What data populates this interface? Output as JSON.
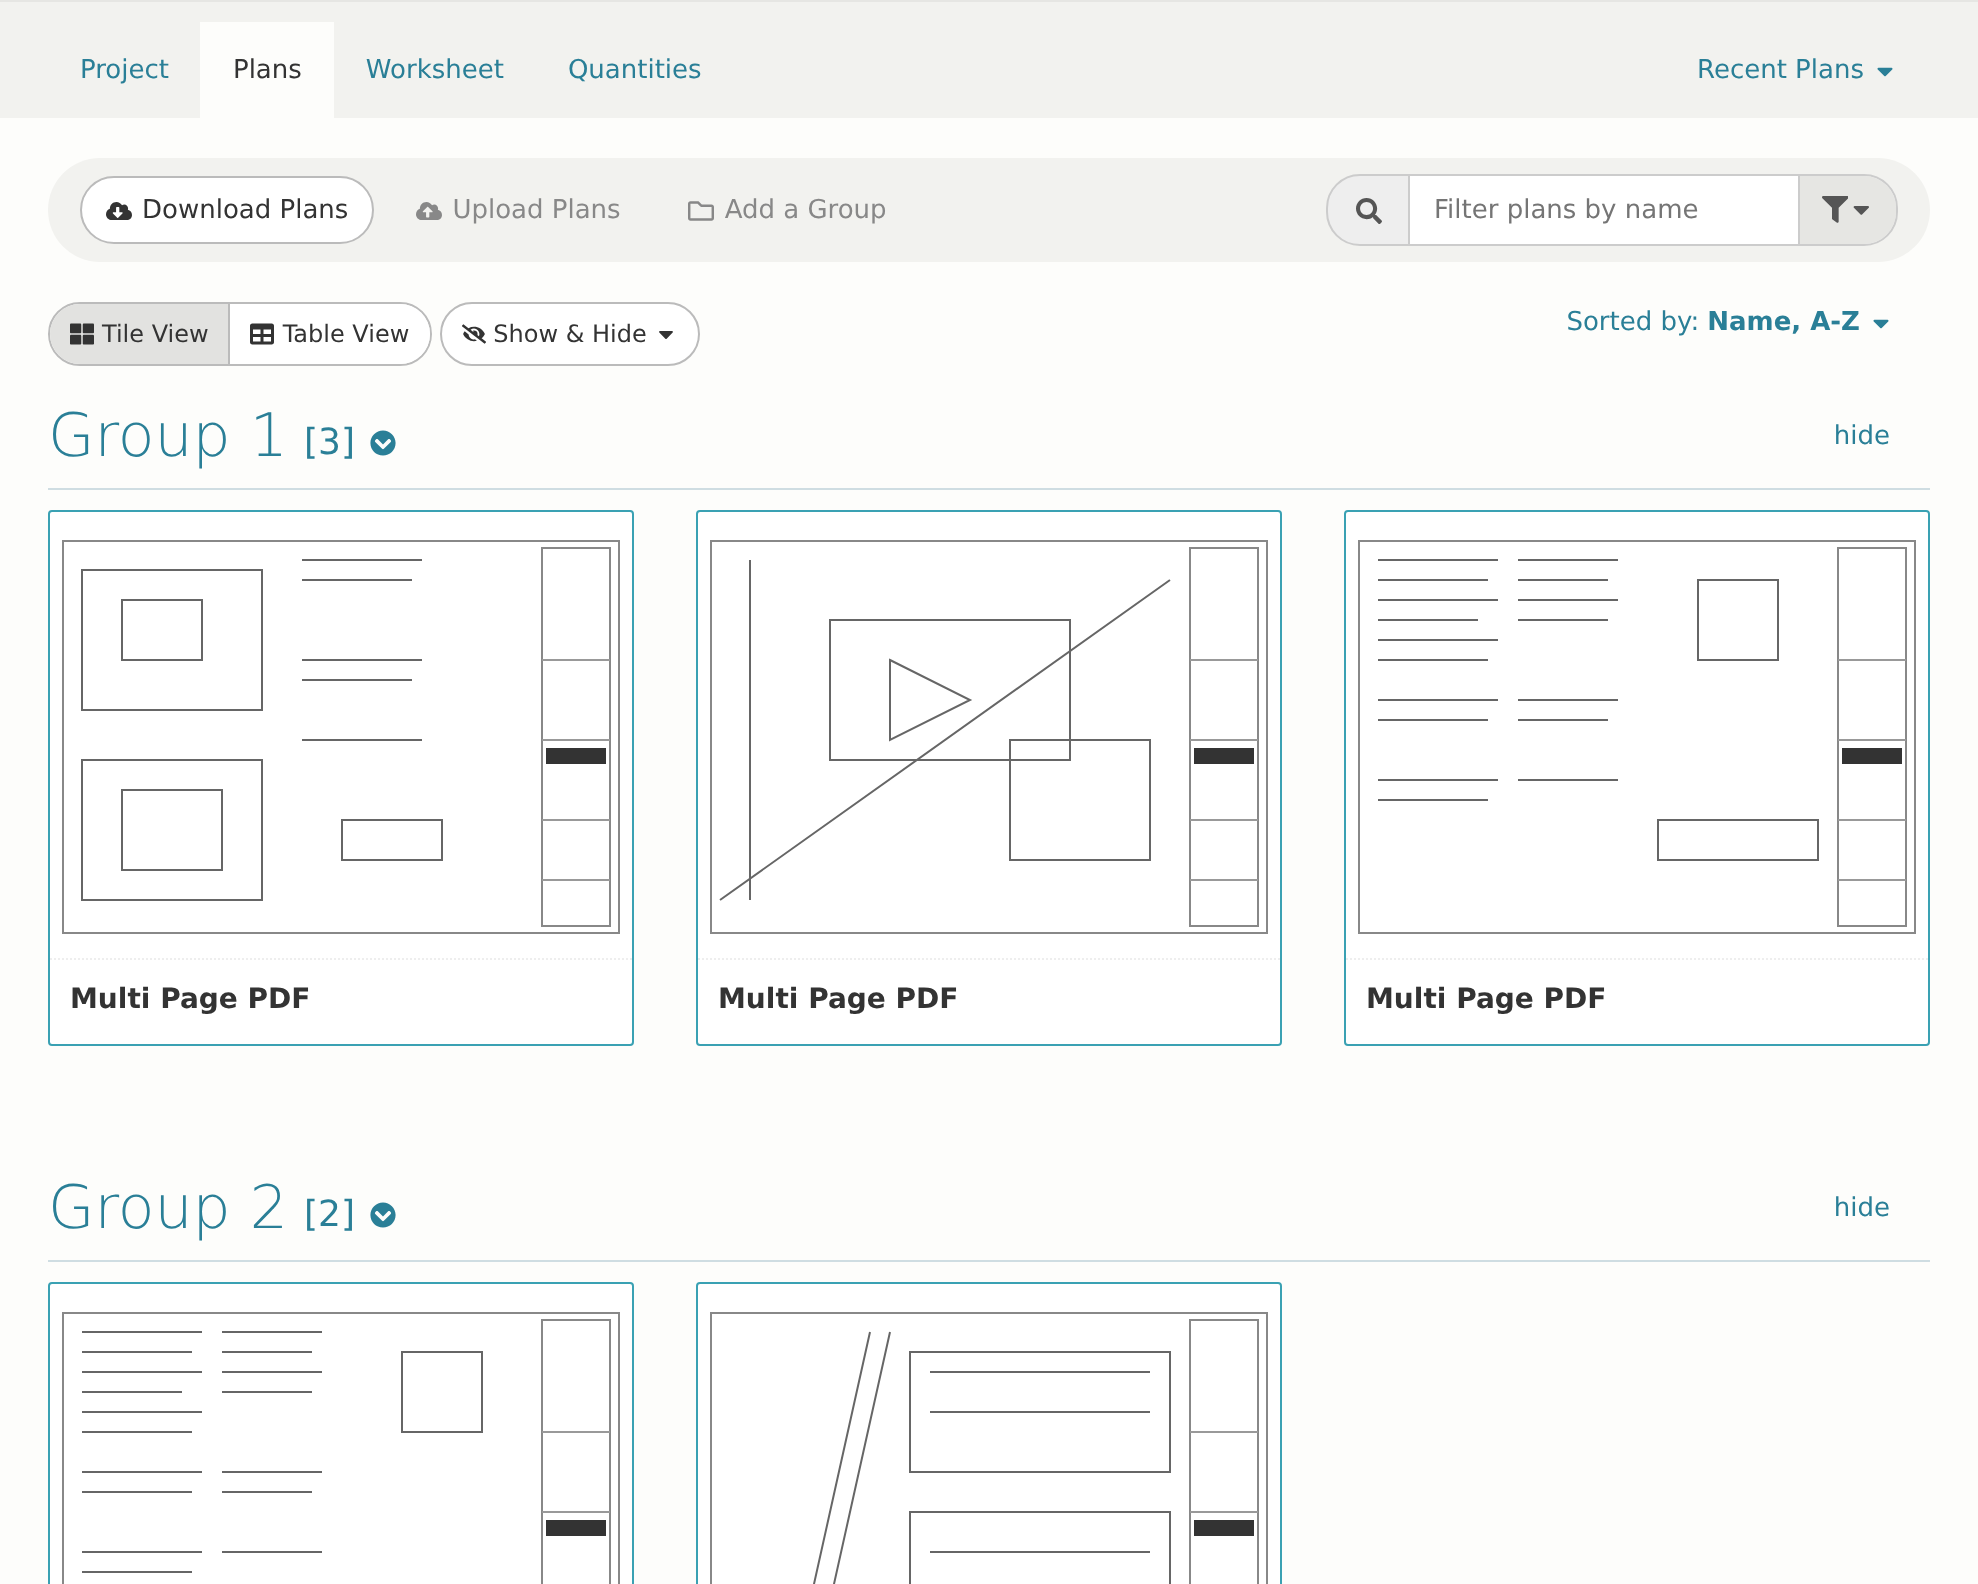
{
  "tabs": [
    {
      "label": "Project",
      "selected": false
    },
    {
      "label": "Plans",
      "selected": true
    },
    {
      "label": "Worksheet",
      "selected": false
    },
    {
      "label": "Quantities",
      "selected": false
    }
  ],
  "recent_plans": "Recent Plans",
  "toolbar": {
    "actions": [
      {
        "label": "Download Plans",
        "kind": "primary"
      },
      {
        "label": "Upload Plans",
        "kind": "upload"
      },
      {
        "label": "Add a Group",
        "kind": "folder"
      }
    ],
    "search": {
      "placeholder": "Filter plans by name"
    }
  },
  "views": [
    {
      "label": "Tile View",
      "kind": "tile",
      "selected": true
    },
    {
      "label": "Table View",
      "kind": "table",
      "selected": false
    }
  ],
  "show_hide": "Show & Hide",
  "sort": {
    "label": "Sorted by:",
    "value": "Name, A-Z"
  },
  "groups": [
    {
      "name": "Group 1",
      "count": "[3]",
      "hide": "hide",
      "plans": [
        {
          "title": "Multi Page PDF",
          "kind": "floor"
        },
        {
          "title": "Multi Page PDF",
          "kind": "site"
        },
        {
          "title": "Multi Page PDF",
          "kind": "schedule"
        }
      ]
    },
    {
      "name": "Group 2",
      "count": "[2]",
      "hide": "hide",
      "plans": [
        {
          "kind": "schedule"
        },
        {
          "kind": "parking"
        }
      ]
    }
  ]
}
